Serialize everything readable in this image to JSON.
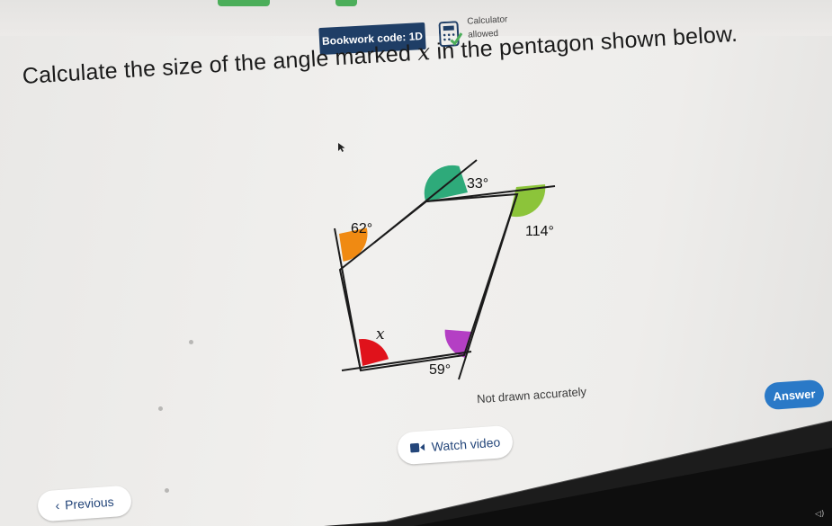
{
  "header": {
    "bookwork_code": "Bookwork code: 1D",
    "calculator_label": "Calculator",
    "calculator_status": "allowed"
  },
  "question": {
    "text_before": "Calculate the size of the angle marked ",
    "variable": "x",
    "text_after": " in the pentagon shown below."
  },
  "diagram": {
    "angles": [
      {
        "label": "33°",
        "color": "#2eaa7a"
      },
      {
        "label": "114°",
        "color": "#8cc43a"
      },
      {
        "label": "59°",
        "color": "#b43fc4"
      },
      {
        "label": "x",
        "color": "#e0121b"
      },
      {
        "label": "62°",
        "color": "#f08a12"
      }
    ],
    "note": "Not drawn accurately"
  },
  "buttons": {
    "answer": "Answer",
    "watch_video": "Watch video",
    "previous": "Previous"
  },
  "colors": {
    "brand_navy": "#1f3e66",
    "answer_blue": "#2a79c7"
  }
}
